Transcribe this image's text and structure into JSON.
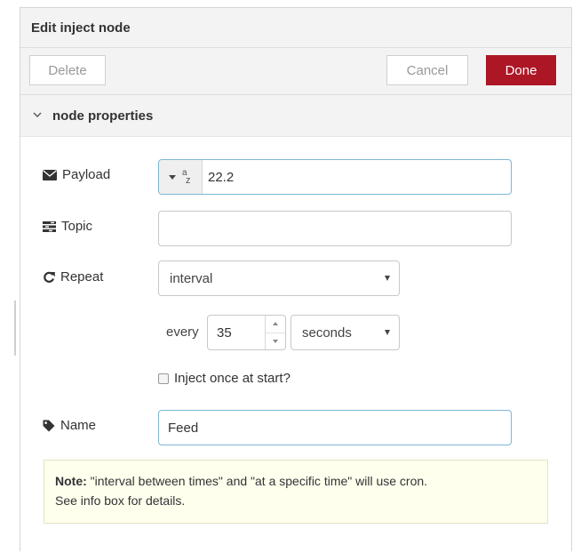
{
  "dialog": {
    "title": "Edit inject node",
    "delete_label": "Delete",
    "cancel_label": "Cancel",
    "done_label": "Done",
    "done_color": "#ad1625"
  },
  "section": {
    "title": "node properties",
    "chevron_icon": "chevron-down-icon"
  },
  "form": {
    "payload": {
      "label": "Payload",
      "icon": "envelope-icon",
      "type_icon": "string-type-icon",
      "value": "22.2"
    },
    "topic": {
      "label": "Topic",
      "icon": "tasks-icon",
      "value": ""
    },
    "repeat": {
      "label": "Repeat",
      "icon": "repeat-icon",
      "selected": "interval",
      "every_label": "every",
      "every_value": "35",
      "units_selected": "seconds"
    },
    "inject_once": {
      "label": "Inject once at start?",
      "checked": false
    },
    "name": {
      "label": "Name",
      "icon": "tag-icon",
      "value": "Feed"
    }
  },
  "note": {
    "prefix": "Note:",
    "text": " \"interval between times\" and \"at a specific time\" will use cron.",
    "line2": "See info box for details."
  }
}
